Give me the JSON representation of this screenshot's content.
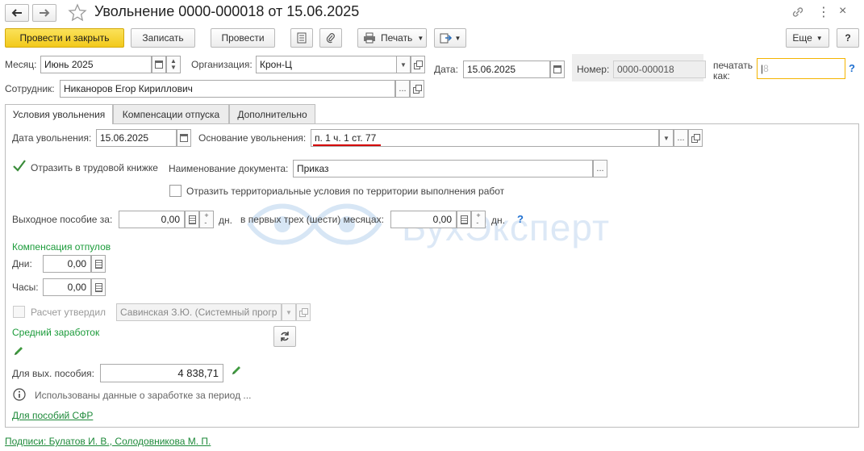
{
  "window": {
    "title": "Увольнение 0000-000018 от 15.06.2025",
    "nav_back": "back",
    "nav_forward": "forward"
  },
  "toolbar": {
    "post_close": "Провести и закрыть",
    "save": "Записать",
    "post": "Провести",
    "print": "Печать",
    "more": "Еще",
    "help": "?"
  },
  "header": {
    "month_label": "Месяц:",
    "month_value": "Июнь 2025",
    "org_label": "Организация:",
    "org_value": "Крон-Ц",
    "date_label": "Дата:",
    "date_value": "15.06.2025",
    "number_label": "Номер:",
    "number_value": "0000-000018",
    "print_as_label": "печатать как:",
    "print_as_placeholder": "8",
    "employee_label": "Сотрудник:",
    "employee_value": "Никаноров Егор Кириллович"
  },
  "tabs": [
    {
      "label": "Условия увольнения",
      "active": true
    },
    {
      "label": "Компенсации отпуска",
      "active": false
    },
    {
      "label": "Дополнительно",
      "active": false
    }
  ],
  "conditions": {
    "dismissal_date_label": "Дата увольнения:",
    "dismissal_date_value": "15.06.2025",
    "basis_label": "Основание увольнения:",
    "basis_value": "п. 1 ч. 1 ст. 77",
    "workbook_checkbox_label": "Отразить в трудовой книжке",
    "workbook_checked": true,
    "doc_name_label": "Наименование документа:",
    "doc_name_value": "Приказ",
    "territorial_label": "Отразить территориальные условия по территории выполнения работ",
    "territorial_checked": false,
    "severance_label": "Выходное пособие за:",
    "severance_value": "0,00",
    "severance_unit": "дн.",
    "first_months_label": "в первых трех (шести) месяцах:",
    "first_months_value": "0,00",
    "first_months_unit": "дн.",
    "help": "?",
    "compensation_header": "Компенсация отпулов",
    "days_label": "Дни:",
    "days_value": "0,00",
    "hours_label": "Часы:",
    "hours_value": "0,00",
    "approved_label": "Расчет утвердил",
    "approved_checked": false,
    "approved_value": "Савинская З.Ю. (Системный прогр",
    "avg_earnings_header": "Средний заработок",
    "severance_avg_label": "Для вых. пособия:",
    "severance_avg_value": "4 838,71",
    "info_text": "Использованы данные о заработке за период ...",
    "sfr_link": "Для пособий СФР"
  },
  "footer": {
    "signatures_link": "Подписи: Булатов И. В., Солодовникова М. П."
  },
  "watermark": "БухЭксперт",
  "colors": {
    "primary_button": "#f2c91b",
    "section_green": "#1b9b3a",
    "link_green": "#1e8a3a",
    "highlight_underline": "#d40000",
    "focus_border": "#f4b400",
    "help_blue": "#1e6fd0"
  }
}
